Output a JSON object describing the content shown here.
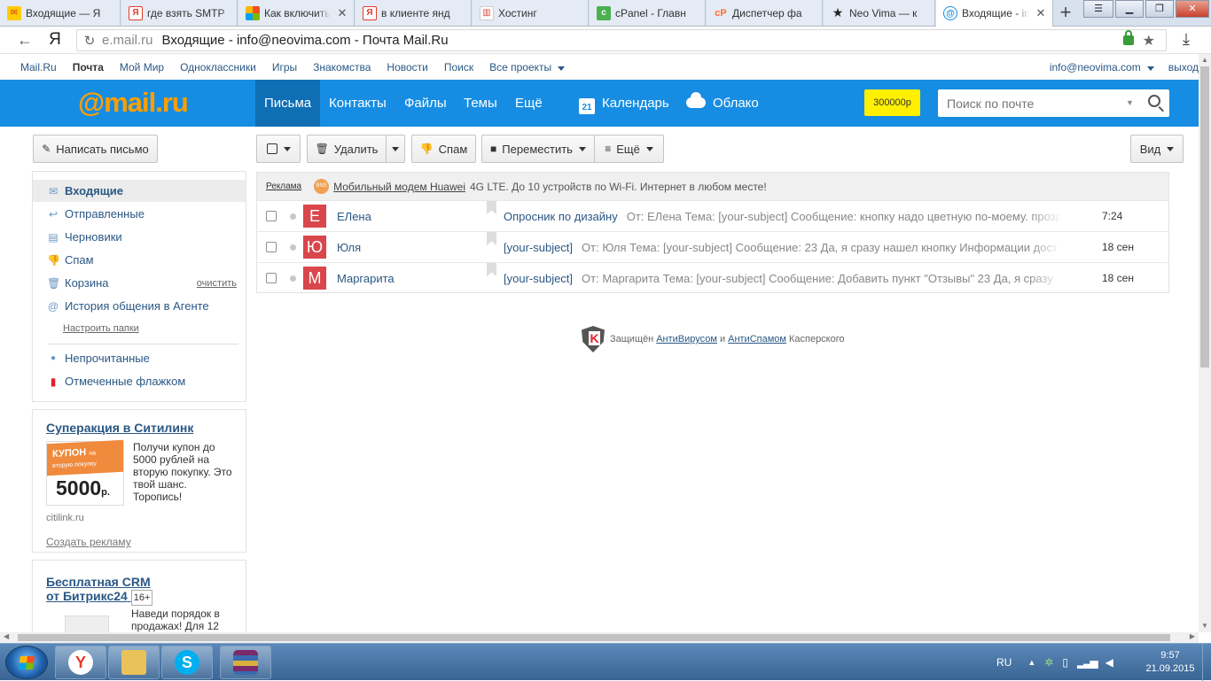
{
  "browser": {
    "tabs": [
      {
        "title": "Входящие — Я",
        "icon": "yandex-mail-icon",
        "color": "#ffcc00"
      },
      {
        "title": "где взять SMTP",
        "icon": "yandex-icon",
        "color": "#e53b2c"
      },
      {
        "title": "Как включить",
        "icon": "microsoft-icon",
        "color": "#7fba00"
      },
      {
        "title": "в клиенте янд",
        "icon": "yandex-icon",
        "color": "#e53b2c"
      },
      {
        "title": "Хостинг",
        "icon": "chart-icon",
        "color": "#e04c3c"
      },
      {
        "title": "cPanel - Главн",
        "icon": "cpanel-icon",
        "color": "#4caf50"
      },
      {
        "title": "Диспетчер фа",
        "icon": "cpanel-orange-icon",
        "color": "#ff6c2c"
      },
      {
        "title": "Neo Vima — к",
        "icon": "star-icon",
        "color": "#222222"
      },
      {
        "title": "Входящие - inf",
        "icon": "mailru-icon",
        "color": "#168de2"
      }
    ],
    "address": {
      "host": "e.mail.ru",
      "page_title": "Входящие - info@neovima.com - Почта Mail.Ru"
    }
  },
  "portal": {
    "links": [
      "Mail.Ru",
      "Почта",
      "Мой Мир",
      "Одноклассники",
      "Игры",
      "Знакомства",
      "Новости",
      "Поиск",
      "Все проекты"
    ],
    "user": "info@neovima.com",
    "logout": "выход"
  },
  "header": {
    "logo": "@mail.ru",
    "nav": [
      "Письма",
      "Контакты",
      "Файлы",
      "Темы",
      "Ещё"
    ],
    "calendar": "Календарь",
    "calendar_day": "21",
    "cloud": "Облако",
    "money": "300000р",
    "search_placeholder": "Поиск по почте"
  },
  "toolbar": {
    "compose": "Написать письмо",
    "delete": "Удалить",
    "spam": "Спам",
    "move": "Переместить",
    "more": "Ещё",
    "view": "Вид"
  },
  "sidebar": {
    "folders": [
      {
        "label": "Входящие",
        "icon": "inbox-icon"
      },
      {
        "label": "Отправленные",
        "icon": "sent-icon"
      },
      {
        "label": "Черновики",
        "icon": "drafts-icon"
      },
      {
        "label": "Спам",
        "icon": "spam-icon"
      },
      {
        "label": "Корзина",
        "icon": "trash-icon"
      },
      {
        "label": "История общения в Агенте",
        "icon": "agent-icon"
      }
    ],
    "clear": "очистить",
    "configure": "Настроить папки",
    "filters": [
      {
        "label": "Непрочитанные",
        "icon": "unread-dot-icon"
      },
      {
        "label": "Отмеченные флажком",
        "icon": "flag-icon"
      }
    ]
  },
  "ads": {
    "citilink": {
      "title": "Суперакция в Ситилинк",
      "coupon_top": "КУПОН",
      "coupon_sub": "на вторую покупку",
      "coupon_value": "5000",
      "coupon_unit": "р.",
      "text": "Получи купон до 5000 рублей на вторую покупку. Это твой шанс. Торопись!",
      "domain": "citilink.ru",
      "create": "Создать рекламу"
    },
    "bitrix": {
      "title_line1": "Бесплатная CRM",
      "title_line2": "от Битрикс24",
      "age": "16+",
      "text": "Наведи порядок в продажах! Для 12"
    }
  },
  "mail": {
    "ad": {
      "label": "Реклама",
      "logo": "BNS",
      "link": "Мобильный модем Huawei",
      "text": "4G LTE. До 10 устройств по Wi-Fi. Интернет в любом месте!"
    },
    "messages": [
      {
        "initial": "Е",
        "from": "ЕЛена",
        "subject": "Опросник по дизайну",
        "preview": "От: ЕЛена Тема: [your-subject] Сообщение: кнопку надо цветную по-моему. прозр",
        "date": "7:24"
      },
      {
        "initial": "Ю",
        "from": "Юля",
        "subject": "[your-subject]",
        "preview": "От: Юля Тема: [your-subject] Сообщение: 23 Да, я сразу нашел кнопку Информации дост",
        "date": "18 сен"
      },
      {
        "initial": "М",
        "from": "Маргарита",
        "subject": "[your-subject]",
        "preview": "От: Маргарита Тема: [your-subject] Сообщение: Добавить пункт \"Отзывы\" 23 Да, я сразу",
        "date": "18 сен"
      }
    ],
    "kaspersky": {
      "prefix": "Защищён",
      "antivirus": "АнтиВирусом",
      "and": "и",
      "antispam": "АнтиСпамом",
      "suffix": "Касперского"
    }
  },
  "taskbar": {
    "apps": [
      {
        "name": "yandex-browser-icon",
        "color": "#e53b2c",
        "glyph": "Y"
      },
      {
        "name": "explorer-icon",
        "color": "#e9c35a",
        "glyph": ""
      },
      {
        "name": "skype-icon",
        "color": "#00aff0",
        "glyph": "S"
      },
      {
        "name": "winrar-icon",
        "color": "#7a2a6a",
        "glyph": ""
      }
    ],
    "lang": "RU",
    "time": "9:57",
    "date": "21.09.2015"
  }
}
